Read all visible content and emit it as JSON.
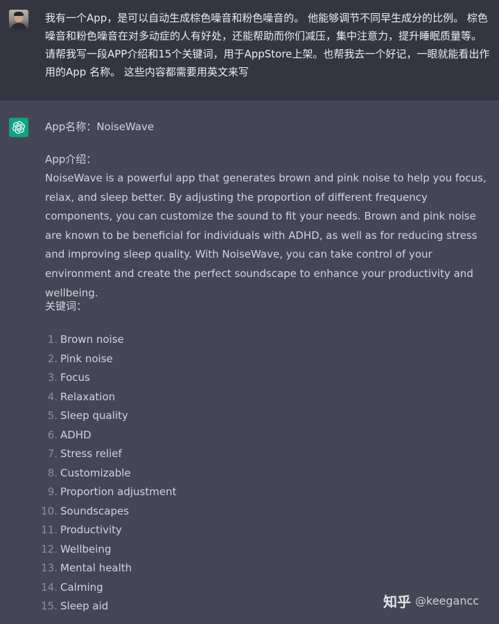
{
  "user_message": {
    "text": "我有一个App，是可以自动生成棕色噪音和粉色噪音的。 他能够调节不同早生成分的比例。 棕色噪音和粉色噪音在对多动症的人有好处，还能帮助而你们减压，集中注意力，提升睡眠质量等。 请帮我写一段APP介绍和15个关键词，用于AppStore上架。也帮我去一个好记，一眼就能看出作用的App 名称。 这些内容都需要用英文来写"
  },
  "assistant_message": {
    "app_name_label": "App名称：",
    "app_name": "NoiseWave",
    "intro_heading": "App介绍：",
    "intro_body": "NoiseWave is a powerful app that generates brown and pink noise to help you focus, relax, and sleep better. By adjusting the proportion of different frequency components, you can customize the sound to fit your needs. Brown and pink noise are known to be beneficial for individuals with ADHD, as well as for reducing stress and improving sleep quality. With NoiseWave, you can take control of your environment and create the perfect soundscape to enhance your productivity and wellbeing.",
    "keywords_heading": "关键词：",
    "keywords": [
      {
        "num": "1.",
        "text": "Brown noise"
      },
      {
        "num": "2.",
        "text": "Pink noise"
      },
      {
        "num": "3.",
        "text": "Focus"
      },
      {
        "num": "4.",
        "text": "Relaxation"
      },
      {
        "num": "5.",
        "text": "Sleep quality"
      },
      {
        "num": "6.",
        "text": "ADHD"
      },
      {
        "num": "7.",
        "text": "Stress relief"
      },
      {
        "num": "8.",
        "text": "Customizable"
      },
      {
        "num": "9.",
        "text": "Proportion adjustment"
      },
      {
        "num": "10.",
        "text": "Soundscapes"
      },
      {
        "num": "11.",
        "text": "Productivity"
      },
      {
        "num": "12.",
        "text": "Wellbeing"
      },
      {
        "num": "13.",
        "text": "Mental health"
      },
      {
        "num": "14.",
        "text": "Calming"
      },
      {
        "num": "15.",
        "text": "Sleep aid"
      }
    ]
  },
  "watermark": {
    "logo": "知乎",
    "handle": "@keegancc"
  },
  "colors": {
    "user_bg": "#343541",
    "assistant_bg": "#444654",
    "bot_avatar": "#10a37f"
  },
  "icons": {
    "user_avatar": "user-photo-avatar",
    "assistant_avatar": "openai-logo-icon"
  }
}
